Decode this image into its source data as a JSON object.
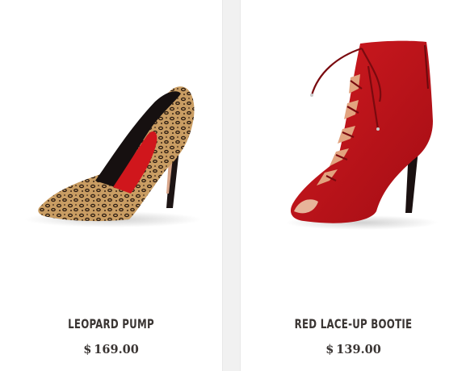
{
  "products": [
    {
      "name": "LEOPARD PUMP",
      "currency": "$",
      "amount": "169.00",
      "image_icon": "leopard-pump-image"
    },
    {
      "name": "RED LACE-UP BOOTIE",
      "currency": "$",
      "amount": "139.00",
      "image_icon": "red-bootie-image"
    }
  ],
  "colors": {
    "page_bg": "#f1f1f1",
    "card_bg": "#ffffff",
    "text": "#3a3533",
    "shoe_red": "#c8141c",
    "leopard_base": "#c9a06a"
  }
}
